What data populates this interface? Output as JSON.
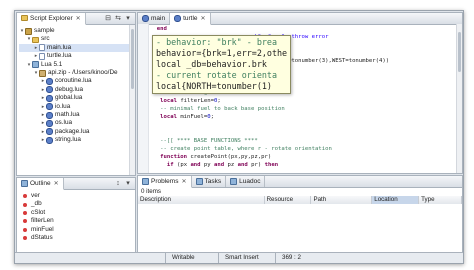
{
  "explorer": {
    "tab_label": "Script Explorer",
    "tree": [
      {
        "label": "sample",
        "icon": "project-icon",
        "twisty": "▾",
        "indent": 0
      },
      {
        "label": "src",
        "icon": "folder-icon",
        "twisty": "▾",
        "indent": 1
      },
      {
        "label": "main.lua",
        "icon": "file-icon",
        "twisty": "▸",
        "indent": 2,
        "selected": true
      },
      {
        "label": "turtle.lua",
        "icon": "file-icon",
        "twisty": "▸",
        "indent": 2
      },
      {
        "label": "Lua 5.1",
        "icon": "library-icon",
        "twisty": "▾",
        "indent": 1
      },
      {
        "label": "api.zip - /Users/kinoo/De",
        "icon": "archive-icon",
        "twisty": "▾",
        "indent": 2
      },
      {
        "label": "coroutine.lua",
        "icon": "lua-file-icon",
        "twisty": "▸",
        "indent": 3
      },
      {
        "label": "debug.lua",
        "icon": "lua-file-icon",
        "twisty": "▸",
        "indent": 3
      },
      {
        "label": "global.lua",
        "icon": "lua-file-icon",
        "twisty": "▸",
        "indent": 3
      },
      {
        "label": "io.lua",
        "icon": "lua-file-icon",
        "twisty": "▸",
        "indent": 3
      },
      {
        "label": "math.lua",
        "icon": "lua-file-icon",
        "twisty": "▸",
        "indent": 3
      },
      {
        "label": "os.lua",
        "icon": "lua-file-icon",
        "twisty": "▸",
        "indent": 3
      },
      {
        "label": "package.lua",
        "icon": "lua-file-icon",
        "twisty": "▸",
        "indent": 3
      },
      {
        "label": "string.lua",
        "icon": "lua-file-icon",
        "twisty": "▸",
        "indent": 3
      }
    ]
  },
  "outline": {
    "tab_label": "Outline",
    "items": [
      "ver",
      "_db",
      "cSlot",
      "filterLen",
      "minFuel",
      "dStatus"
    ]
  },
  "editor": {
    "tabs": [
      {
        "label": "main",
        "active": false
      },
      {
        "label": "turtle",
        "active": true
      }
    ],
    "lines": [
      [
        {
          "t": "  end",
          "c": "kw"
        }
      ],
      [
        {
          "t": "                              ck\", \"err\"- throw error",
          "c": "str"
        }
      ],
      [
        {
          "t": "",
          "c": ""
        }
      ],
      [
        {
          "t": "                                              ",
          "c": ""
        }
      ],
      [
        {
          "t": "                           umber(2),SOUTH=tonumber(3),WEST=tonumber(4))",
          "c": ""
        }
      ],
      [
        {
          "t": "",
          "c": ""
        }
      ],
      [
        {
          "t": "",
          "c": ""
        }
      ],
      [
        {
          "t": "   local ",
          "c": "kw"
        },
        {
          "t": "_db=behavior.brk",
          "c": ""
        }
      ],
      [
        {
          "t": "   -- filter length",
          "c": "cmt"
        }
      ],
      [
        {
          "t": "   local ",
          "c": "kw"
        },
        {
          "t": "filterLen=",
          "c": ""
        },
        {
          "t": "0",
          "c": "num"
        },
        {
          "t": ";",
          "c": ""
        }
      ],
      [
        {
          "t": "   -- minimal fuel to back base position",
          "c": "cmt"
        }
      ],
      [
        {
          "t": "   local ",
          "c": "kw"
        },
        {
          "t": "minFuel=",
          "c": ""
        },
        {
          "t": "0",
          "c": "num"
        },
        {
          "t": ";",
          "c": ""
        }
      ],
      [
        {
          "t": "",
          "c": ""
        }
      ],
      [
        {
          "t": "",
          "c": ""
        }
      ],
      [
        {
          "t": "   --[[ **** BASE FUNCTIONS ****",
          "c": "cmt"
        }
      ],
      [
        {
          "t": "   -- create point table, where r - rotate orientation",
          "c": "cmt"
        }
      ],
      [
        {
          "t": "   function ",
          "c": "kw"
        },
        {
          "t": "createPoint(px,py,pz,pr)",
          "c": ""
        }
      ],
      [
        {
          "t": "     if ",
          "c": "kw"
        },
        {
          "t": "(px ",
          "c": ""
        },
        {
          "t": "and ",
          "c": "kw"
        },
        {
          "t": "py ",
          "c": ""
        },
        {
          "t": "and ",
          "c": "kw"
        },
        {
          "t": "pz ",
          "c": ""
        },
        {
          "t": "and ",
          "c": "kw"
        },
        {
          "t": "pr) ",
          "c": ""
        },
        {
          "t": "then",
          "c": "kw"
        }
      ]
    ],
    "hover_lines": [
      "- behavior: \"brk\" - brea",
      "behavior={brk=1,err=2,othe",
      "local _db=behavior.brk",
      "- current rotate orienta",
      "local{NORTH=tonumber(1)"
    ]
  },
  "problems": {
    "tabs": [
      {
        "label": "Problems",
        "active": true
      },
      {
        "label": "Tasks",
        "active": false
      },
      {
        "label": "Luadoc",
        "active": false
      }
    ],
    "summary": "0 items",
    "columns": [
      "Description",
      "Resource",
      "Path",
      "Location",
      "Type"
    ],
    "sorted_column": "Location"
  },
  "statusbar": {
    "mode": "Writable",
    "insert": "Smart Insert",
    "position": "369 : 2"
  },
  "colors": {
    "keyword": "#7f0055",
    "comment": "#3f7f5f",
    "string": "#2a00ff",
    "number": "#0000c0",
    "selection": "#3875d7"
  }
}
